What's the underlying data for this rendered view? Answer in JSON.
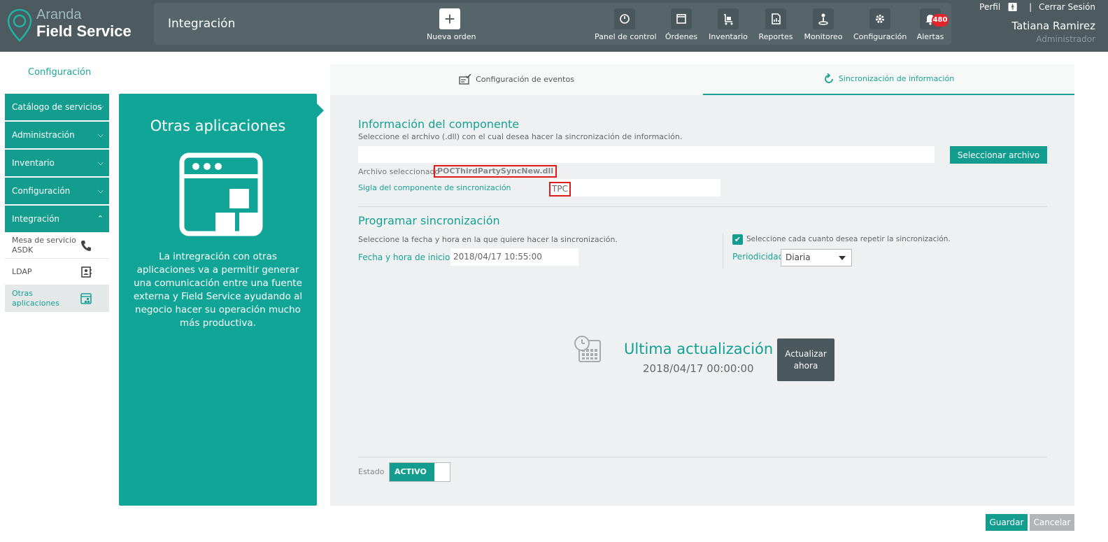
{
  "brand": {
    "line1": "Aranda",
    "line2": "Field Service"
  },
  "header": {
    "title": "Integración",
    "new_order": "Nueva orden",
    "nav": [
      {
        "label": "Panel de control",
        "icon": "dashboard-icon"
      },
      {
        "label": "Órdenes",
        "icon": "orders-icon"
      },
      {
        "label": "Inventario",
        "icon": "inventory-icon"
      },
      {
        "label": "Reportes",
        "icon": "reports-icon"
      },
      {
        "label": "Monitoreo",
        "icon": "monitoring-icon"
      },
      {
        "label": "Configuración",
        "icon": "gear-icon"
      },
      {
        "label": "Alertas",
        "icon": "bell-icon",
        "badge": "480"
      }
    ],
    "profile": "Perfil",
    "separator": "|",
    "logout": "Cerrar Sesión",
    "user_name": "Tatiana Ramirez",
    "user_role": "Administrador"
  },
  "sidebar": {
    "title": "Configuración",
    "items": [
      {
        "label": "Catálogo de servicios"
      },
      {
        "label": "Administración"
      },
      {
        "label": "Inventario"
      },
      {
        "label": "Configuración"
      },
      {
        "label": "Integración"
      }
    ],
    "subitems": [
      {
        "label": "Mesa de servicio ASDK",
        "icon": "phone-icon"
      },
      {
        "label": "LDAP",
        "icon": "address-book-icon"
      },
      {
        "label": "Otras aplicaciones",
        "icon": "apps-window-icon",
        "active": true
      }
    ]
  },
  "info_panel": {
    "title": "Otras aplicaciones",
    "text": "La intregración con otras aplicaciones va a permitir generar una comunicación entre una fuente externa y Field Service ayudando al negocio hacer su operación mucho más productiva."
  },
  "tabs": [
    {
      "label": "Configuración de eventos",
      "icon": "event-config-icon"
    },
    {
      "label": "Sincronización de información",
      "icon": "sync-icon",
      "active": true
    }
  ],
  "component": {
    "title": "Información del componente",
    "hint": "Seleccione el archivo (.dll) con el cual desea hacer la sincronización de información.",
    "file_input_value": "",
    "select_file_button": "Seleccionar archivo",
    "selected_label": "Archivo seleccionado",
    "selected_file": "POCThirdPartySyncNew.dll",
    "sigla_label": "Sigla del componente de sincronización",
    "sigla_value": "TPC"
  },
  "schedule": {
    "title": "Programar sincronización",
    "hint": "Seleccione la fecha y hora en la que quiere hacer la sincronización.",
    "date_label": "Fecha y hora de inicio",
    "date_value": "2018/04/17 10:55:00",
    "repeat_label": "Seleccione cada cuanto desea repetir la sincronización.",
    "repeat_checked": true,
    "period_label": "Periodicidad",
    "period_value": "Diaria"
  },
  "last_update": {
    "title": "Ultima actualización",
    "date": "2018/04/17 00:00:00",
    "update_button_line1": "Actualizar",
    "update_button_line2": "ahora"
  },
  "status": {
    "label": "Estado",
    "value": "ACTIVO"
  },
  "footer": {
    "save": "Guardar",
    "cancel": "Cancelar"
  },
  "colors": {
    "topbar": "#4d5b60",
    "accent": "#129d8f",
    "highlight": "#e01b1b",
    "badge": "#e3242b"
  }
}
